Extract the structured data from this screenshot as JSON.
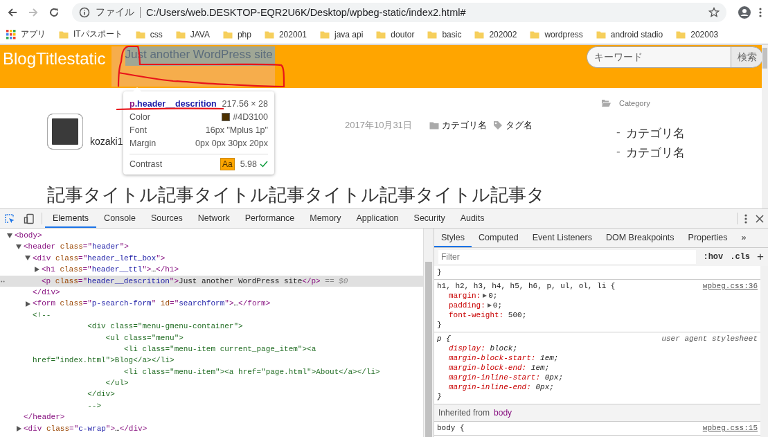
{
  "address": {
    "security_label": "ファイル",
    "url": "C:/Users/web.DESKTOP-EQR2U6K/Desktop/wpbeg-static/index2.html#"
  },
  "bookmarks": [
    {
      "kind": "apps",
      "label": "アプリ"
    },
    {
      "kind": "folder",
      "label": "ITパスポート"
    },
    {
      "kind": "folder",
      "label": "css"
    },
    {
      "kind": "folder",
      "label": "JAVA"
    },
    {
      "kind": "folder",
      "label": "php"
    },
    {
      "kind": "folder",
      "label": "202001"
    },
    {
      "kind": "folder",
      "label": "java api"
    },
    {
      "kind": "folder",
      "label": "doutor"
    },
    {
      "kind": "folder",
      "label": "basic"
    },
    {
      "kind": "folder",
      "label": "202002"
    },
    {
      "kind": "folder",
      "label": "wordpress"
    },
    {
      "kind": "folder",
      "label": "android stadio"
    },
    {
      "kind": "folder",
      "label": "202003"
    }
  ],
  "page": {
    "header": {
      "title": "BlogTitlestatic",
      "description": "Just another WordPress site",
      "search": {
        "placeholder": "キーワード",
        "button": "検索"
      }
    },
    "post": {
      "author": "kozaki1",
      "date": "2017年10月31日",
      "category": "カテゴリ名",
      "tag": "タグ名",
      "title": "記事タイトル記事タイトル記事タイトル記事タイトル記事タ"
    },
    "sidebar": {
      "heading": "Category",
      "items": [
        {
          "bullet": "-",
          "label": "カテゴリ名"
        },
        {
          "bullet": "-",
          "label": "カテゴリ名"
        }
      ]
    },
    "inspect_tooltip": {
      "tag": "p",
      "class": ".header__descrition",
      "size": "217.56 × 28",
      "rows": [
        {
          "kind": "color",
          "label": "Color",
          "value": "#4D3100"
        },
        {
          "kind": "text",
          "label": "Font",
          "value": "16px \"Mplus 1p\""
        },
        {
          "kind": "text",
          "label": "Margin",
          "value": "0px 0px 30px 20px"
        },
        {
          "kind": "contrast",
          "label": "Contrast",
          "badge": "Aa",
          "value": "5.98",
          "passes": true
        }
      ]
    }
  },
  "devtools": {
    "tabs": [
      {
        "label": "Elements",
        "selected": true
      },
      {
        "label": "Console",
        "selected": false
      },
      {
        "label": "Sources",
        "selected": false
      },
      {
        "label": "Network",
        "selected": false
      },
      {
        "label": "Performance",
        "selected": false
      },
      {
        "label": "Memory",
        "selected": false
      },
      {
        "label": "Application",
        "selected": false
      },
      {
        "label": "Security",
        "selected": false
      },
      {
        "label": "Audits",
        "selected": false
      }
    ],
    "dom": [
      {
        "kind": "element",
        "expanded": true,
        "selected": false,
        "parts": [
          {
            "kind": "tag",
            "text": "<body>"
          }
        ],
        "children": [
          {
            "kind": "element",
            "expanded": true,
            "selected": false,
            "parts": [
              {
                "kind": "tag",
                "text": "<header "
              },
              {
                "kind": "attr",
                "text": "class"
              },
              {
                "kind": "tag",
                "text": "=\""
              },
              {
                "kind": "val",
                "text": "header"
              },
              {
                "kind": "tag",
                "text": "\">"
              }
            ],
            "close": [
              {
                "kind": "tag",
                "text": "</header>"
              }
            ],
            "children": [
              {
                "kind": "element",
                "expanded": true,
                "selected": false,
                "parts": [
                  {
                    "kind": "tag",
                    "text": "<div "
                  },
                  {
                    "kind": "attr",
                    "text": "class"
                  },
                  {
                    "kind": "tag",
                    "text": "=\""
                  },
                  {
                    "kind": "val",
                    "text": "header_left_box"
                  },
                  {
                    "kind": "tag",
                    "text": "\">"
                  }
                ],
                "close": [
                  {
                    "kind": "tag",
                    "text": "</div>"
                  }
                ],
                "children": [
                  {
                    "kind": "element",
                    "expanded": false,
                    "selected": false,
                    "parts": [
                      {
                        "kind": "tag",
                        "text": "<h1 "
                      },
                      {
                        "kind": "attr",
                        "text": "class"
                      },
                      {
                        "kind": "tag",
                        "text": "=\""
                      },
                      {
                        "kind": "val",
                        "text": "header__ttl"
                      },
                      {
                        "kind": "tag",
                        "text": "\">"
                      },
                      {
                        "kind": "text",
                        "text": "…"
                      },
                      {
                        "kind": "tag",
                        "text": "</h1>"
                      }
                    ]
                  },
                  {
                    "kind": "leaf",
                    "selected": true,
                    "parts": [
                      {
                        "kind": "tag",
                        "text": "<p "
                      },
                      {
                        "kind": "attr",
                        "text": "class"
                      },
                      {
                        "kind": "tag",
                        "text": "=\""
                      },
                      {
                        "kind": "val",
                        "text": "header__descrition"
                      },
                      {
                        "kind": "tag",
                        "text": "\">"
                      },
                      {
                        "kind": "text",
                        "text": "Just another WordPress site"
                      },
                      {
                        "kind": "tag",
                        "text": "</p>"
                      },
                      {
                        "kind": "dim",
                        "text": " == $0"
                      }
                    ]
                  }
                ]
              },
              {
                "kind": "element",
                "expanded": false,
                "selected": false,
                "parts": [
                  {
                    "kind": "tag",
                    "text": "<form "
                  },
                  {
                    "kind": "attr",
                    "text": "class"
                  },
                  {
                    "kind": "tag",
                    "text": "=\""
                  },
                  {
                    "kind": "val",
                    "text": "p-search-form"
                  },
                  {
                    "kind": "tag",
                    "text": "\" "
                  },
                  {
                    "kind": "attr",
                    "text": "id"
                  },
                  {
                    "kind": "tag",
                    "text": "=\""
                  },
                  {
                    "kind": "val",
                    "text": "searchform"
                  },
                  {
                    "kind": "tag",
                    "text": "\">"
                  },
                  {
                    "kind": "text",
                    "text": "…"
                  },
                  {
                    "kind": "tag",
                    "text": "</form>"
                  }
                ]
              },
              {
                "kind": "comment",
                "selected": false,
                "lines": [
                  "<!--",
                  "            <div class=\"menu-gmenu-container\">",
                  "                <ul class=\"menu\">",
                  "                    <li class=\"menu-item current_page_item\"><a",
                  "href=\"index.html\">Blog</a></li>",
                  "                    <li class=\"menu-item\"><a href=\"page.html\">About</a></li>",
                  "                </ul>",
                  "            </div>",
                  "            -->"
                ]
              }
            ]
          },
          {
            "kind": "element",
            "expanded": false,
            "selected": false,
            "parts": [
              {
                "kind": "tag",
                "text": "<div "
              },
              {
                "kind": "attr",
                "text": "class"
              },
              {
                "kind": "tag",
                "text": "=\""
              },
              {
                "kind": "val",
                "text": "c-wrap"
              },
              {
                "kind": "tag",
                "text": "\">"
              },
              {
                "kind": "text",
                "text": "…"
              },
              {
                "kind": "tag",
                "text": "</div>"
              }
            ]
          }
        ]
      }
    ],
    "styles": {
      "tabs": [
        {
          "label": "Styles",
          "selected": true
        },
        {
          "label": "Computed",
          "selected": false
        },
        {
          "label": "Event Listeners",
          "selected": false
        },
        {
          "label": "DOM Breakpoints",
          "selected": false
        },
        {
          "label": "Properties",
          "selected": false
        }
      ],
      "more": "»",
      "filter": {
        "placeholder": "Filter"
      },
      "toggles": [
        ":hov",
        ".cls"
      ],
      "add": "+",
      "rules": [
        {
          "kind": "tail",
          "close": "}"
        },
        {
          "kind": "author",
          "selector": "h1, h2, h3, h4, h5, h6, p, ul, ol, li {",
          "source": "wpbeg.css:36",
          "close": "}",
          "props": [
            {
              "name": "margin:",
              "value": "0;",
              "expandable": true
            },
            {
              "name": "padding:",
              "value": "0;",
              "expandable": true
            },
            {
              "name": "font-weight:",
              "value": "500;"
            }
          ]
        },
        {
          "kind": "ua",
          "selector": "p {",
          "source": "user agent stylesheet",
          "close": "}",
          "props": [
            {
              "name": "display:",
              "value": "block;"
            },
            {
              "name": "margin-block-start:",
              "value": "1em;"
            },
            {
              "name": "margin-block-end:",
              "value": "1em;"
            },
            {
              "name": "margin-inline-start:",
              "value": "0px;"
            },
            {
              "name": "margin-inline-end:",
              "value": "0px;"
            }
          ]
        },
        {
          "kind": "inherited",
          "label": "Inherited from",
          "element": "body"
        },
        {
          "kind": "author",
          "selector": "body {",
          "source": "wpbeg.css:15"
        }
      ]
    }
  }
}
